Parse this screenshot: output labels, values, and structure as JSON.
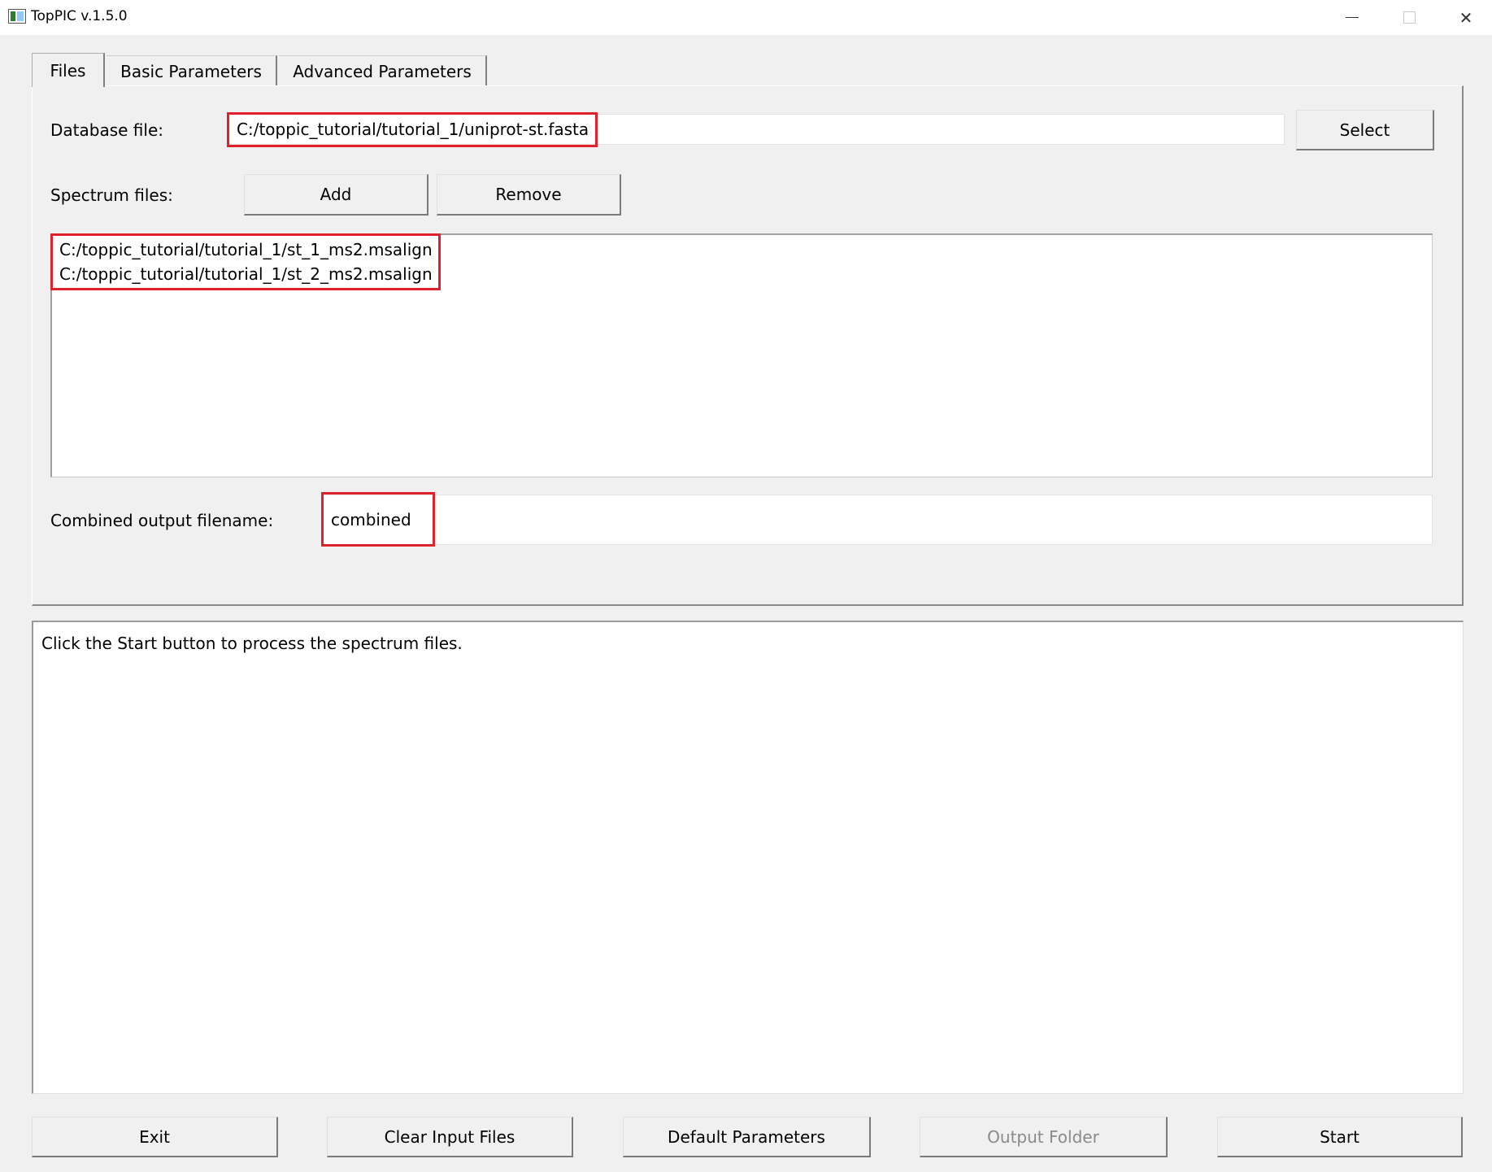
{
  "window": {
    "title": "TopPIC v.1.5.0",
    "minimize_icon": "minimize-icon",
    "maximize_icon": "maximize-icon",
    "close_icon": "close-icon",
    "close_glyph": "✕"
  },
  "tabs": [
    {
      "label": "Files",
      "selected": true
    },
    {
      "label": "Basic Parameters",
      "selected": false
    },
    {
      "label": "Advanced Parameters",
      "selected": false
    }
  ],
  "files_tab": {
    "database_label": "Database file:",
    "database_value": "C:/toppic_tutorial/tutorial_1/uniprot-st.fasta",
    "select_button": "Select",
    "spectrum_label": "Spectrum files:",
    "add_button": "Add",
    "remove_button": "Remove",
    "spectrum_files": [
      "C:/toppic_tutorial/tutorial_1/st_1_ms2.msalign",
      "C:/toppic_tutorial/tutorial_1/st_2_ms2.msalign"
    ],
    "combined_label": "Combined output filename:",
    "combined_value": "combined"
  },
  "log": {
    "message": "Click the Start button to process the spectrum files."
  },
  "footer": {
    "exit_button": "Exit",
    "clear_button": "Clear Input Files",
    "default_button": "Default Parameters",
    "output_button": "Output Folder",
    "start_button": "Start"
  },
  "highlight_color": "#e0202a"
}
